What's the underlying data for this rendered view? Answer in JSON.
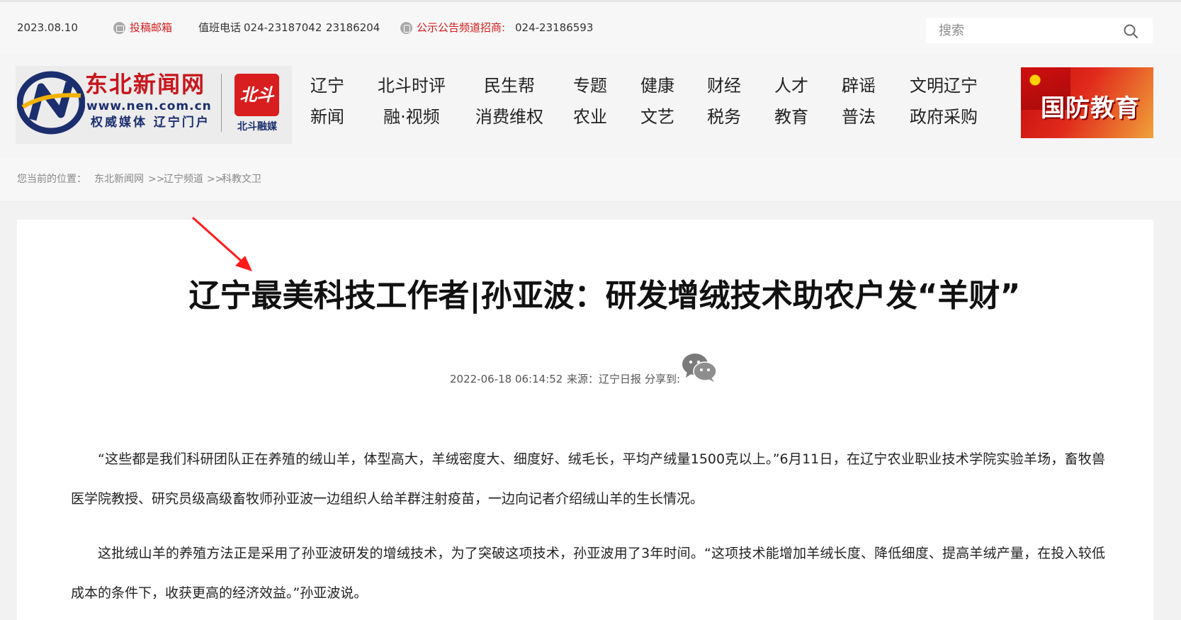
{
  "topbar": {
    "date": "2023.08.10",
    "submit_email": "投稿邮箱",
    "duty_phone_label": "值班电话",
    "duty_phone_numbers": "024-23187042",
    "duty_phone_numbers_2": "23186204",
    "ad_label": "公示公告频道招商:",
    "ad_phone": "024-23186593",
    "search_placeholder": "搜索"
  },
  "logo": {
    "name_cn": "东北新闻网",
    "url": "www.nen.com.cn",
    "slogan": "权威媒体  辽宁门户",
    "badge_text": "北斗",
    "badge_name": "北斗融媒"
  },
  "nav": [
    {
      "top": "辽宁",
      "bottom": "新闻"
    },
    {
      "top": "北斗时评",
      "bottom": "融·视频"
    },
    {
      "top": "民生帮",
      "bottom": "消费维权"
    },
    {
      "top": "专题",
      "bottom": "农业"
    },
    {
      "top": "健康",
      "bottom": "文艺"
    },
    {
      "top": "财经",
      "bottom": "税务"
    },
    {
      "top": "人才",
      "bottom": "教育"
    },
    {
      "top": "辟谣",
      "bottom": "普法"
    },
    {
      "top": "文明辽宁",
      "bottom": "政府采购"
    }
  ],
  "banner": {
    "text": "国防教育"
  },
  "breadcrumb": {
    "prefix": "您当前的位置：",
    "home": "东北新闻网",
    "sep1": ">>",
    "channel": "辽宁频道",
    "sep2": ">>",
    "section": "科教文卫"
  },
  "article": {
    "title": "辽宁最美科技工作者|孙亚波：研发增绒技术助农户发“羊财”",
    "datetime": "2022-06-18 06:14:52",
    "source": "来源：辽宁日报",
    "share_label": "分享到:",
    "paragraphs": [
      "“这些都是我们科研团队正在养殖的绒山羊，体型高大，羊绒密度大、细度好、绒毛长，平均产绒量1500克以上。”6月11日，在辽宁农业职业技术学院实验羊场，畜牧兽医学院教授、研究员级高级畜牧师孙亚波一边组织人给羊群注射疫苗，一边向记者介绍绒山羊的生长情况。",
      "这批绒山羊的养殖方法正是采用了孙亚波研发的增绒技术，为了突破这项技术，孙亚波用了3年时间。“这项技术能增加羊绒长度、降低细度、提高羊绒产量，在投入较低成本的条件下，收获更高的经济效益。”孙亚波说。"
    ]
  },
  "colors": {
    "accent_red": "#d21c1c",
    "brand_blue": "#1b2e6e"
  }
}
